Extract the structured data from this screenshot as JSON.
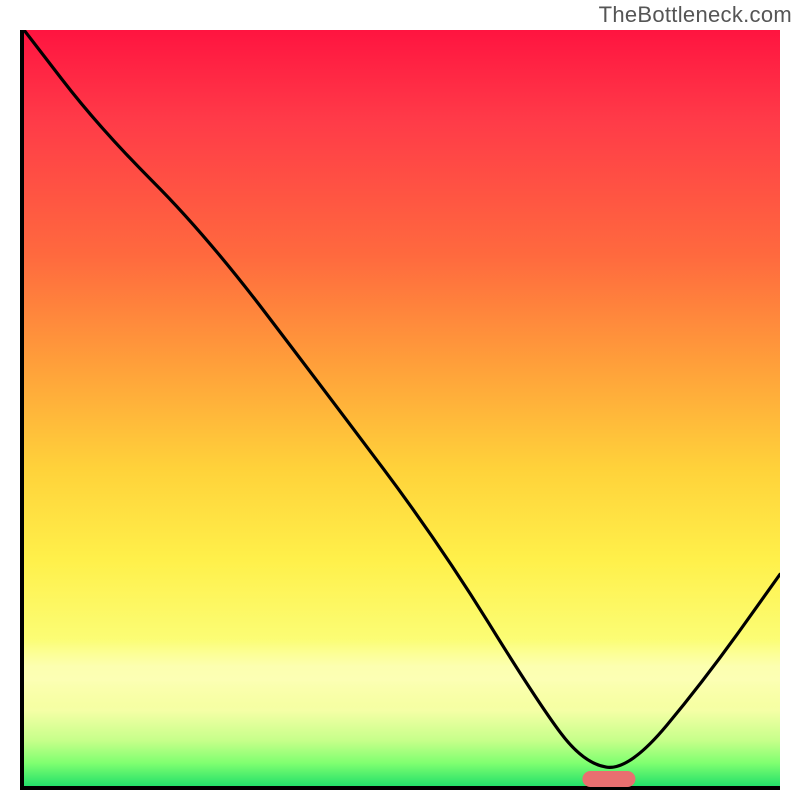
{
  "watermark": "TheBottleneck.com",
  "chart_data": {
    "type": "line",
    "title": "",
    "xlabel": "",
    "ylabel": "",
    "xlim": [
      0,
      100
    ],
    "ylim": [
      0,
      100
    ],
    "grid": false,
    "legend": false,
    "background_gradient": {
      "direction": "vertical",
      "stops": [
        {
          "pos": 0,
          "color": "#ff1440"
        },
        {
          "pos": 0.3,
          "color": "#ff6a3e"
        },
        {
          "pos": 0.58,
          "color": "#ffd23a"
        },
        {
          "pos": 0.82,
          "color": "#fbff7a"
        },
        {
          "pos": 0.97,
          "color": "#7fff70"
        },
        {
          "pos": 1.0,
          "color": "#24e06a"
        }
      ]
    },
    "series": [
      {
        "name": "bottleneck-curve",
        "color": "#000000",
        "x": [
          0,
          10,
          24,
          40,
          55,
          68,
          74,
          80,
          90,
          100
        ],
        "y": [
          100,
          87,
          73,
          52,
          32,
          11,
          3,
          2,
          14,
          28
        ]
      }
    ],
    "markers": [
      {
        "name": "optimal-range",
        "shape": "rounded-bar",
        "color": "#e96f70",
        "x": 77,
        "y": 1.5,
        "width": 7
      }
    ],
    "axes": {
      "left": true,
      "bottom": true,
      "ticks": false
    }
  }
}
